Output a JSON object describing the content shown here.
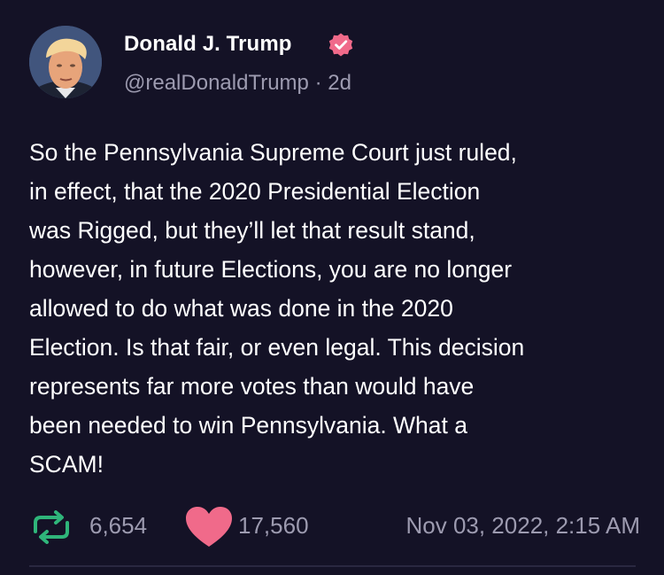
{
  "post": {
    "author": {
      "display_name": "Donald J. Trump",
      "handle": "@realDonaldTrump",
      "separator": "·",
      "age": "2d",
      "verified_icon": "verified-badge-icon",
      "avatar": "profile-photo"
    },
    "body_lines": [
      "So the Pennsylvania Supreme Court just ruled,",
      "in effect, that the 2020 Presidential Election",
      "was Rigged, but they’ll let that result stand,",
      "however, in future Elections, you are no longer",
      "allowed to do what was done in the 2020",
      "Election. Is that fair, or even legal. This decision",
      "represents far more votes than would have",
      "been needed to win Pennsylvania. What a",
      "SCAM!"
    ],
    "stats": {
      "reposts": "6,654",
      "likes": "17,560",
      "repost_icon": "repost-icon",
      "like_icon": "heart-icon"
    },
    "timestamp": "Nov 03, 2022, 2:15 AM"
  },
  "colors": {
    "background": "#141226",
    "text": "#ffffff",
    "muted": "#9d9bb0",
    "accent_green": "#2fb57a",
    "accent_pink": "#f06a8a",
    "verified": "#f06a8a"
  }
}
